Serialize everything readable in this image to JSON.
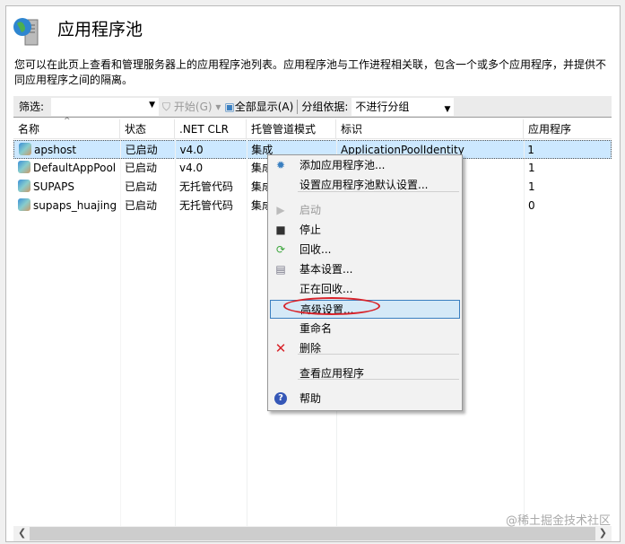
{
  "header": {
    "title": "应用程序池",
    "description": "您可以在此页上查看和管理服务器上的应用程序池列表。应用程序池与工作进程相关联，包含一个或多个应用程序，并提供不同应用程序之间的隔离。"
  },
  "toolbar": {
    "filter_label": "筛选:",
    "filter_value": "",
    "start_label": "开始(G)",
    "show_all_label": "全部显示(A)",
    "group_by_label": "分组依据:",
    "group_by_value": "不进行分组"
  },
  "table": {
    "columns": [
      "名称",
      "状态",
      ".NET CLR",
      "托管管道模式",
      "标识",
      "应用程序"
    ],
    "rows": [
      [
        "apshost",
        "已启动",
        "v4.0",
        "集成",
        "ApplicationPoolIdentity",
        "1"
      ],
      [
        "DefaultAppPool",
        "已启动",
        "v4.0",
        "集成",
        "",
        "1"
      ],
      [
        "SUPAPS",
        "已启动",
        "无托管代码",
        "集成",
        "",
        "1"
      ],
      [
        "supaps_huajing",
        "已启动",
        "无托管代码",
        "集成",
        "",
        "0"
      ]
    ],
    "selected_row": 0,
    "sort_column": "名称"
  },
  "context_menu": {
    "items": [
      {
        "label": "添加应用程序池...",
        "icon": "add-pool-icon"
      },
      {
        "label": "设置应用程序池默认设置...",
        "icon": ""
      },
      {
        "label": "启动",
        "icon": "play-icon",
        "disabled": true
      },
      {
        "label": "停止",
        "icon": "stop-icon"
      },
      {
        "label": "回收...",
        "icon": "recycle-icon"
      },
      {
        "label": "基本设置...",
        "icon": "settings-icon"
      },
      {
        "label": "正在回收...",
        "icon": ""
      },
      {
        "label": "高级设置...",
        "icon": "",
        "highlighted": true
      },
      {
        "label": "重命名",
        "icon": ""
      },
      {
        "label": "删除",
        "icon": "delete-icon"
      },
      {
        "label": "查看应用程序",
        "icon": ""
      },
      {
        "label": "帮助",
        "icon": "help-icon"
      }
    ]
  },
  "watermark": "@稀土掘金技术社区",
  "colors": {
    "selection": "#cce8ff",
    "menu_highlight": "#d5e9f7",
    "annotation": "#d8232a"
  }
}
